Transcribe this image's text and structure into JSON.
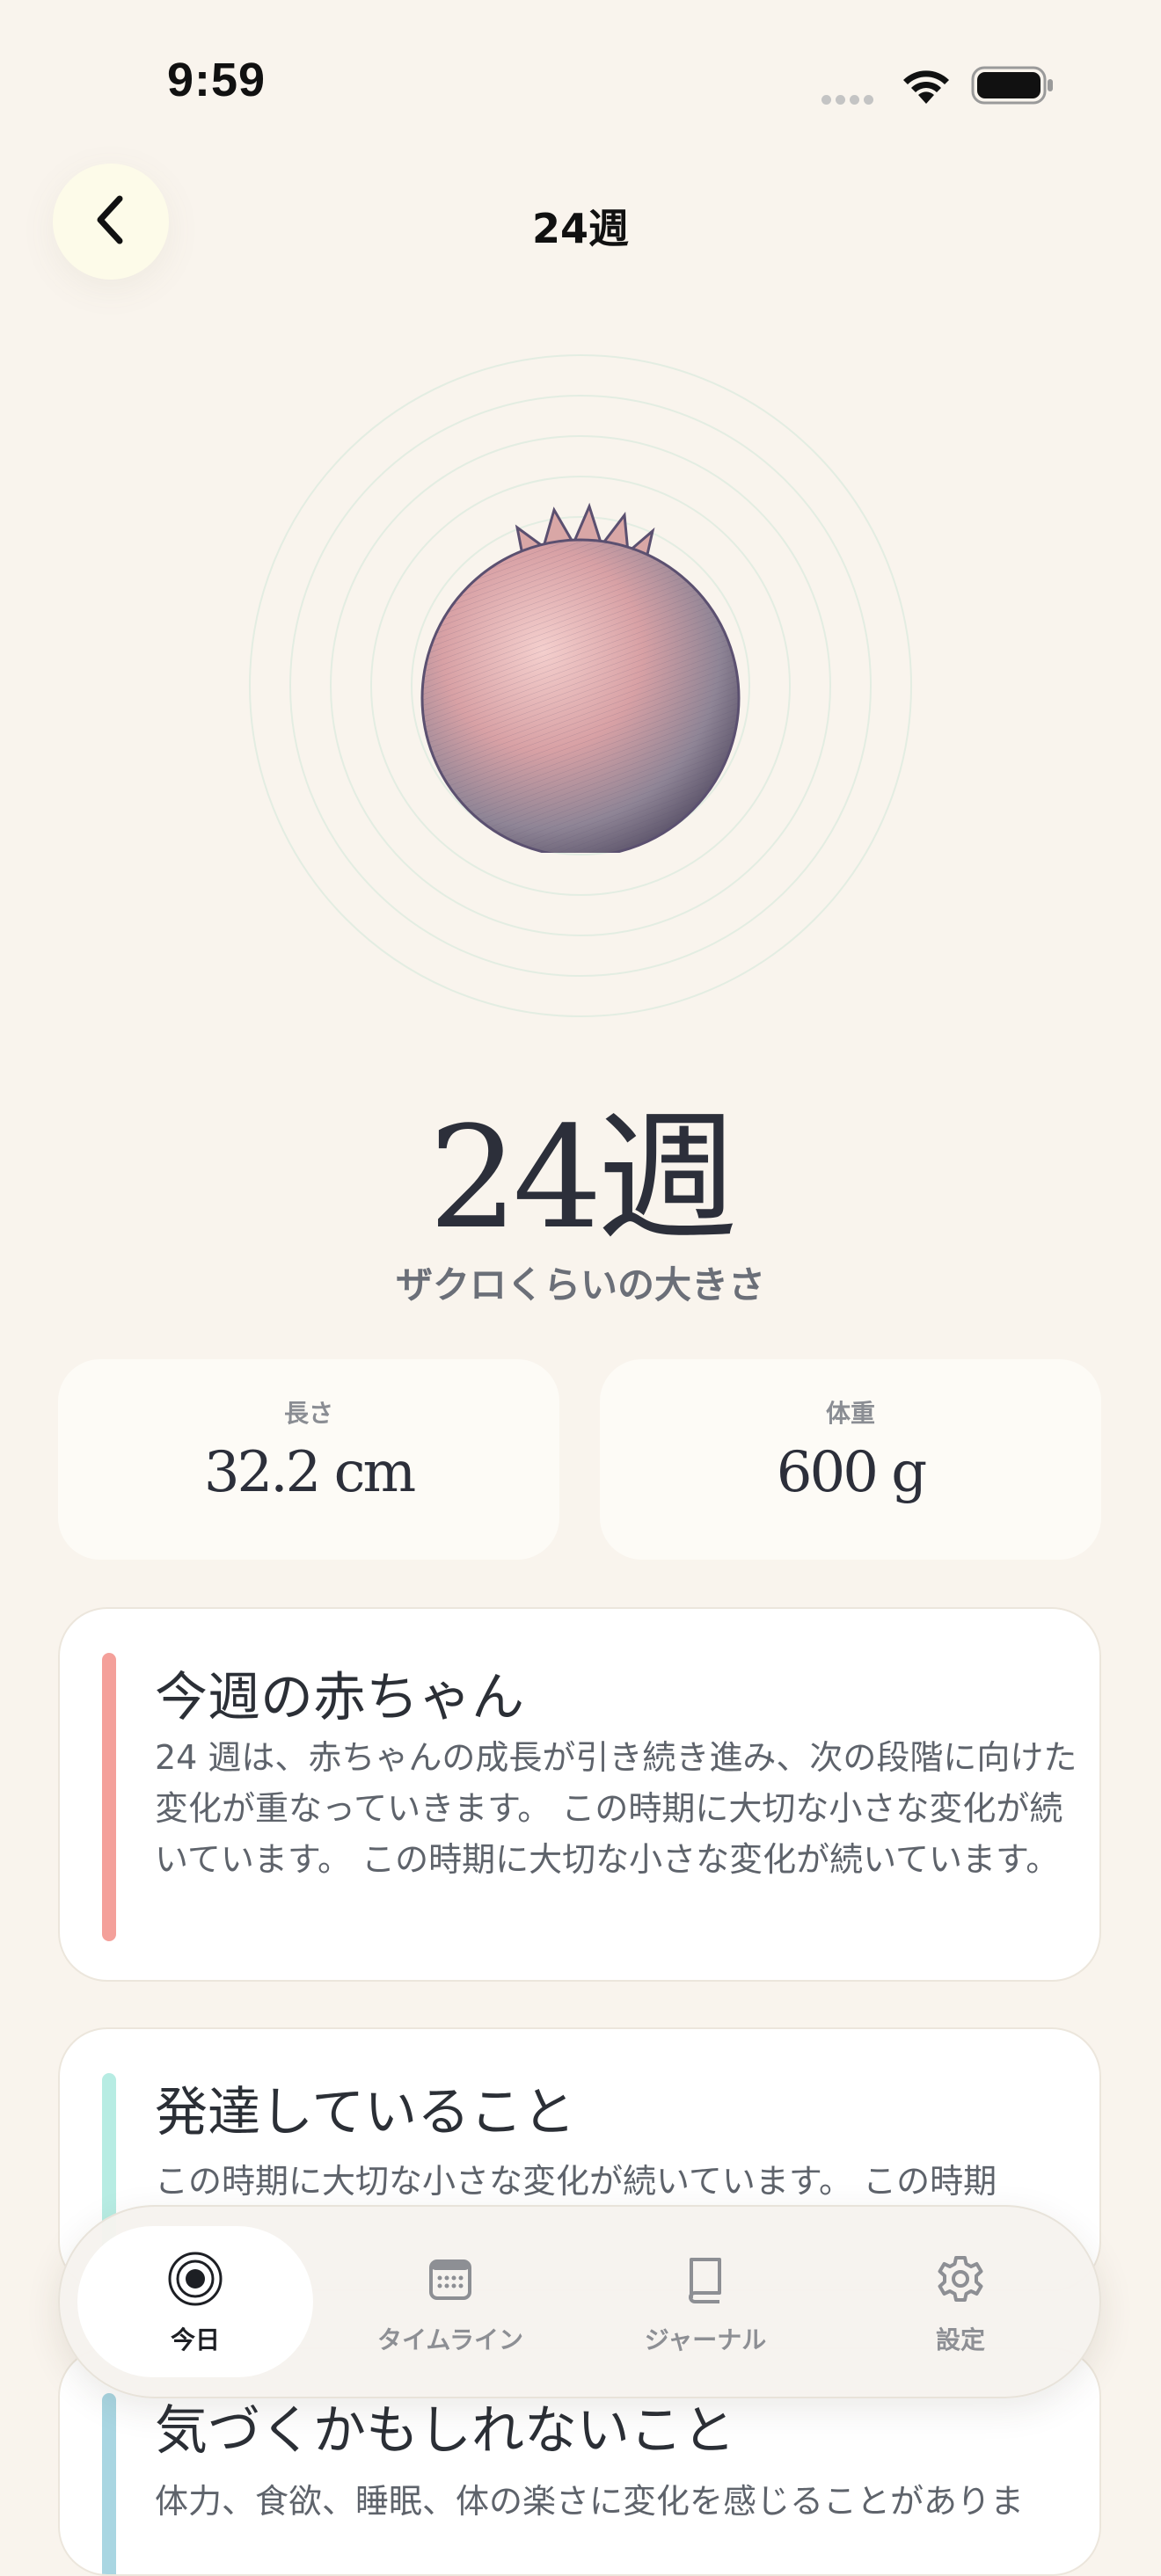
{
  "status_bar": {
    "time": "9:59"
  },
  "nav": {
    "title": "24週"
  },
  "hero": {
    "image": "pomegranate-illustration",
    "week_heading": "24週",
    "size_caption": "ザクロくらいの大きさ"
  },
  "stats": {
    "length": {
      "label": "長さ",
      "value": "32.2 cm"
    },
    "weight": {
      "label": "体重",
      "value": "600 g"
    }
  },
  "cards": {
    "baby": {
      "title": "今週の赤ちゃん",
      "body": "24 週は、赤ちゃんの成長が引き続き進み、次の段階に向けた変化が重なっていきます。 この時期に大切な小さな変化が続いています。 この時期に大切な小さな変化が続いています。",
      "accent": "#f4a09a"
    },
    "develop": {
      "title": "発達していること",
      "body": "この時期に大切な小さな変化が続いています。 この時期",
      "accent": "#b7ece3"
    },
    "notice": {
      "title": "気づくかもしれないこと",
      "body": "体力、食欲、睡眠、体の楽さに変化を感じることがありま",
      "accent": "#a9d6e2"
    }
  },
  "tab_bar": {
    "items": [
      {
        "label": "今日",
        "icon": "target-icon",
        "active": true
      },
      {
        "label": "タイムライン",
        "icon": "calendar-icon",
        "active": false
      },
      {
        "label": "ジャーナル",
        "icon": "book-icon",
        "active": false
      },
      {
        "label": "設定",
        "icon": "gear-icon",
        "active": false
      }
    ]
  }
}
